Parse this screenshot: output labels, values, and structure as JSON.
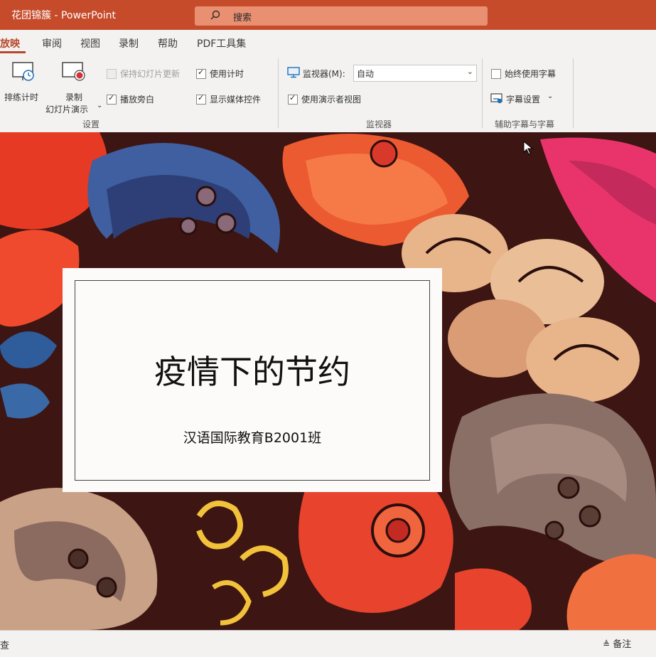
{
  "window": {
    "title": "花团锦簇 - PowerPoint"
  },
  "search": {
    "placeholder": "搜索"
  },
  "tabs": [
    {
      "label": "放映",
      "active": true
    },
    {
      "label": "审阅"
    },
    {
      "label": "视图"
    },
    {
      "label": "录制"
    },
    {
      "label": "帮助"
    },
    {
      "label": "PDF工具集"
    }
  ],
  "ribbon": {
    "rehearse_label": "排练计时",
    "record_label_line1": "录制",
    "record_label_line2": "幻灯片演示",
    "keep_updated_label": "保持幻灯片更新",
    "use_timings_label": "使用计时",
    "play_narration_label": "播放旁白",
    "show_media_controls_label": "显示媒体控件",
    "settings_group_label": "设置",
    "monitor_label": "监视器(M):",
    "monitor_value": "自动",
    "presenter_view_label": "使用演示者视图",
    "monitors_group_label": "监视器",
    "always_subtitles_label": "始终使用字幕",
    "subtitle_settings_label": "字幕设置",
    "captions_group_label": "辅助字幕与字幕",
    "checkbox_state": {
      "keep_updated": false,
      "use_timings": true,
      "play_narration": true,
      "show_media_controls": true,
      "presenter_view": true,
      "always_subtitles": false
    }
  },
  "slide": {
    "title": "疫情下的节约",
    "subtitle": "汉语国际教育B2001班"
  },
  "status": {
    "left_text": "查",
    "notes_label": "备注"
  },
  "colors": {
    "accent": "#b7472a",
    "titlebar": "#c64b2a",
    "ribbon_bg": "#f3f2f1"
  }
}
